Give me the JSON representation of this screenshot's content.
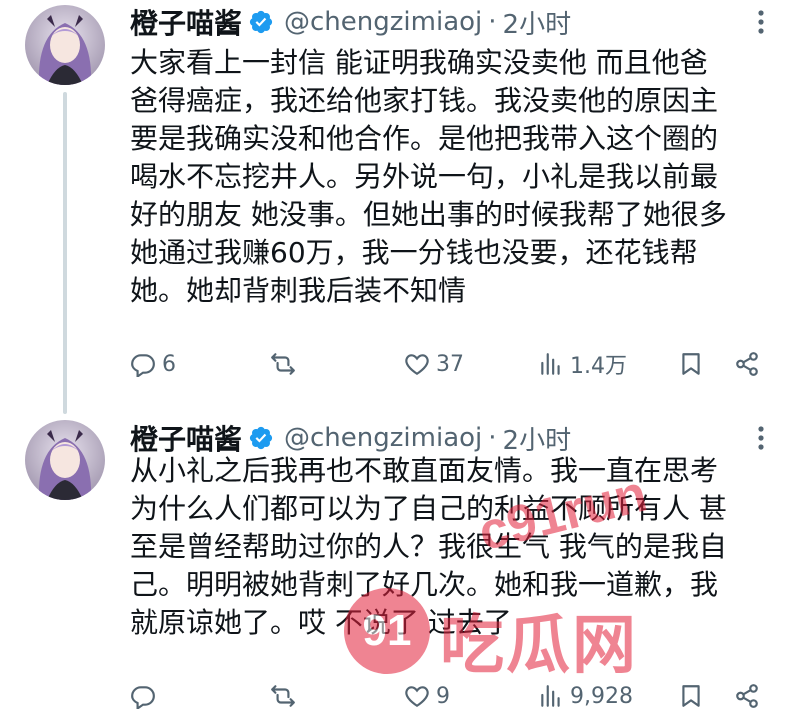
{
  "tweets": [
    {
      "display_name": "橙子喵酱",
      "handle": "@chengzimiaoj",
      "dot": "·",
      "time": "2小时",
      "lines": [
        "大家看上一封信 能证明我确实没卖他 而且他爸",
        "爸得癌症，我还给他家打钱。我没卖他的原因主",
        "要是我确实没和他合作。是他把我带入这个圈的",
        "喝水不忘挖井人。另外说一句，小礼是我以前最",
        "好的朋友 她没事。但她出事的时候我帮了她很多",
        "她通过我赚60万，我一分钱也没要，还花钱帮",
        "她。她却背刺我后装不知情"
      ],
      "stats": {
        "replies": "6",
        "reposts": "",
        "likes": "37",
        "views": "1.4万"
      }
    },
    {
      "display_name": "橙子喵酱",
      "handle": "@chengzimiaoj",
      "dot": "·",
      "time": "2小时",
      "lines": [
        "从小礼之后我再也不敢直面友情。我一直在思考",
        "为什么人们都可以为了自己的利益不顾所有人 甚",
        "至是曾经帮助过你的人？我很生气 我气的是我自",
        "己。明明被她背刺了好几次。她和我一道歉，我",
        "就原谅她了。哎 不说了 过去了"
      ],
      "stats": {
        "replies": "",
        "reposts": "",
        "likes": "9",
        "views": "9,928"
      }
    }
  ],
  "icons": {
    "verified": "verified-badge-icon",
    "more": "more-icon",
    "reply": "reply-icon",
    "repost": "repost-icon",
    "like": "heart-icon",
    "views": "views-icon",
    "bookmark": "bookmark-icon",
    "share": "share-icon"
  },
  "colors": {
    "accent": "#1d9bf0",
    "text": "#0f1419",
    "muted": "#536471",
    "thread_line": "#cfd9de",
    "watermark": "#e3203a"
  },
  "watermark": {
    "number": "91",
    "site": "c91run",
    "brand": "吃瓜网"
  }
}
